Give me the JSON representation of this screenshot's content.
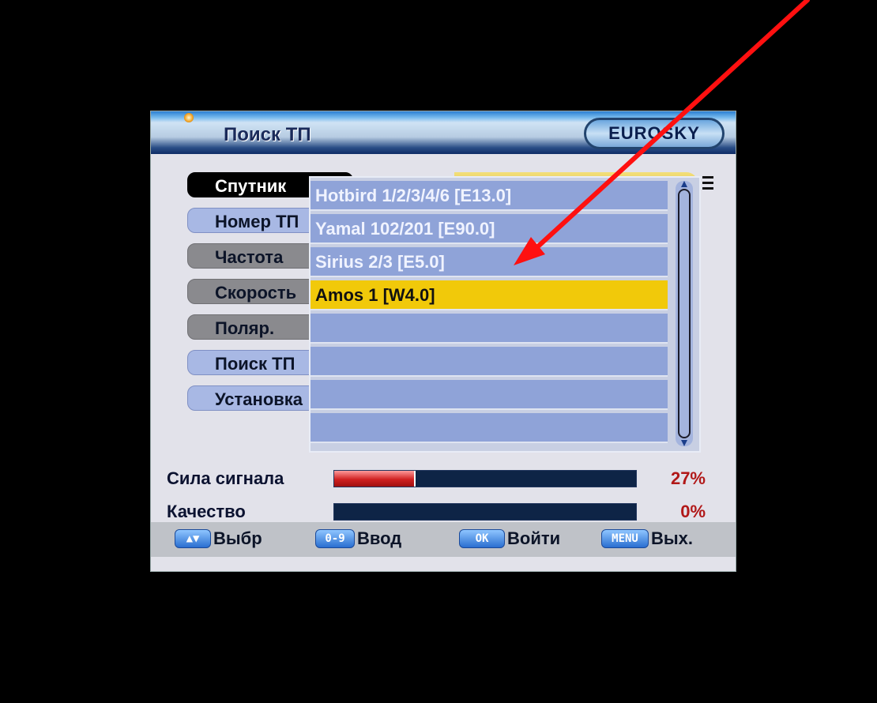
{
  "header": {
    "title": "Поиск ТП",
    "logo_text": "EUROSKY"
  },
  "menu": [
    {
      "label": "Спутник",
      "state": "active"
    },
    {
      "label": "Номер ТП",
      "state": "normal"
    },
    {
      "label": "Частота",
      "state": "disabled"
    },
    {
      "label": "Скорость",
      "state": "disabled"
    },
    {
      "label": "Поляр.",
      "state": "disabled"
    },
    {
      "label": "Поиск ТП",
      "state": "normal"
    },
    {
      "label": "Установка",
      "state": "normal"
    }
  ],
  "satellite_list": {
    "items": [
      "Hotbird 1/2/3/4/6 [E13.0]",
      "Yamal 102/201 [E90.0]",
      "Sirius 2/3 [E5.0]",
      "Amos 1 [W4.0]",
      "",
      "",
      "",
      ""
    ],
    "selected_index": 3
  },
  "signal": {
    "strength_label": "Сила сигнала",
    "strength_value": "27%",
    "strength_fraction": 0.27,
    "quality_label": "Качество",
    "quality_value": "0%",
    "quality_fraction": 0.0
  },
  "help_bar": [
    {
      "key": "▲▼",
      "label": "Выбр"
    },
    {
      "key": "0-9",
      "label": "Ввод"
    },
    {
      "key": "OK",
      "label": "Войти"
    },
    {
      "key": "MENU",
      "label": "Вых."
    }
  ],
  "colors": {
    "selection": "#f1c90a",
    "list_row": "#8fa3d8",
    "annotation_arrow": "#ff1010",
    "signal_fill": "#d02020",
    "bar_background": "#0e2446"
  }
}
